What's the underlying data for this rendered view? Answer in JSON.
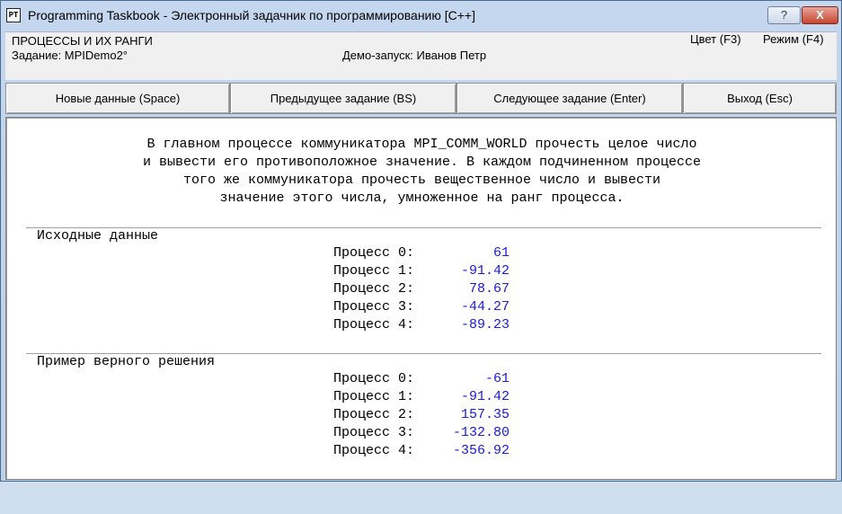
{
  "window": {
    "title": "Programming Taskbook - Электронный задачник по программированию [C++]",
    "app_icon_text": "PT",
    "help_button": "?",
    "close_button": "X"
  },
  "info": {
    "topic": "ПРОЦЕССЫ И ИХ РАНГИ",
    "task": "Задание: MPIDemo2°",
    "demo": "Демо-запуск: Иванов Петр",
    "color_option": "Цвет (F3)",
    "mode_option": "Режим (F4)"
  },
  "toolbar": {
    "new_data": "Новые данные (Space)",
    "prev_task": "Предыдущее задание (BS)",
    "next_task": "Следующее задание (Enter)",
    "exit": "Выход (Esc)"
  },
  "description": [
    "В главном процессе коммуникатора MPI_COMM_WORLD прочесть целое число",
    "и вывести его противоположное значение. В каждом подчиненном процессе",
    "того же коммуникатора прочесть вещественное число и вывести",
    "значение этого числа, умноженное на ранг процесса."
  ],
  "input_section": {
    "title": "Исходные данные",
    "rows": [
      {
        "label": "Процесс 0:",
        "value": "61"
      },
      {
        "label": "Процесс 1:",
        "value": "-91.42"
      },
      {
        "label": "Процесс 2:",
        "value": "78.67"
      },
      {
        "label": "Процесс 3:",
        "value": "-44.27"
      },
      {
        "label": "Процесс 4:",
        "value": "-89.23"
      }
    ]
  },
  "example_section": {
    "title": "Пример верного решения",
    "rows": [
      {
        "label": "Процесс 0:",
        "value": "-61"
      },
      {
        "label": "Процесс 1:",
        "value": "-91.42"
      },
      {
        "label": "Процесс 2:",
        "value": "157.35"
      },
      {
        "label": "Процесс 3:",
        "value": "-132.80"
      },
      {
        "label": "Процесс 4:",
        "value": "-356.92"
      }
    ]
  },
  "colors": {
    "value_text": "#1a1ad8",
    "title_bar": "#c4d7ef",
    "close_button": "#c7442e"
  }
}
